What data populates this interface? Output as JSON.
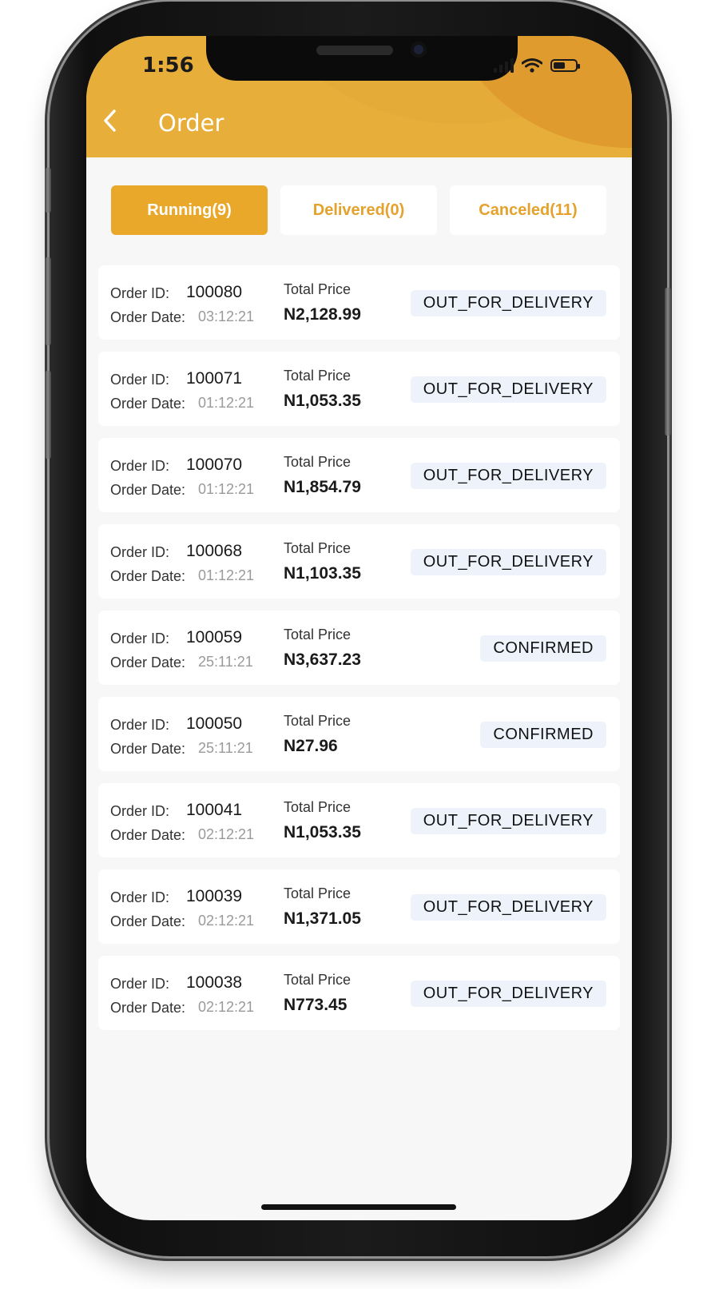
{
  "status_bar": {
    "time": "1:56"
  },
  "header": {
    "title": "Order",
    "back_icon": "chevron-left-icon",
    "color": "#e7ae3a"
  },
  "tabs": [
    {
      "label": "Running(9)",
      "active": true
    },
    {
      "label": "Delivered(0)",
      "active": false
    },
    {
      "label": "Canceled(11)",
      "active": false
    }
  ],
  "labels": {
    "order_id": "Order ID:",
    "order_date": "Order Date:",
    "total_price": "Total Price"
  },
  "orders": [
    {
      "id": "100080",
      "date": "03:12:21",
      "total": "N2,128.99",
      "status": "OUT_FOR_DELIVERY"
    },
    {
      "id": "100071",
      "date": "01:12:21",
      "total": "N1,053.35",
      "status": "OUT_FOR_DELIVERY"
    },
    {
      "id": "100070",
      "date": "01:12:21",
      "total": "N1,854.79",
      "status": "OUT_FOR_DELIVERY"
    },
    {
      "id": "100068",
      "date": "01:12:21",
      "total": "N1,103.35",
      "status": "OUT_FOR_DELIVERY"
    },
    {
      "id": "100059",
      "date": "25:11:21",
      "total": "N3,637.23",
      "status": "CONFIRMED"
    },
    {
      "id": "100050",
      "date": "25:11:21",
      "total": "N27.96",
      "status": "CONFIRMED"
    },
    {
      "id": "100041",
      "date": "02:12:21",
      "total": "N1,053.35",
      "status": "OUT_FOR_DELIVERY"
    },
    {
      "id": "100039",
      "date": "02:12:21",
      "total": "N1,371.05",
      "status": "OUT_FOR_DELIVERY"
    },
    {
      "id": "100038",
      "date": "02:12:21",
      "total": "N773.45",
      "status": "OUT_FOR_DELIVERY"
    }
  ],
  "colors": {
    "accent": "#e9a82a",
    "badge_bg": "#eef3fb"
  }
}
